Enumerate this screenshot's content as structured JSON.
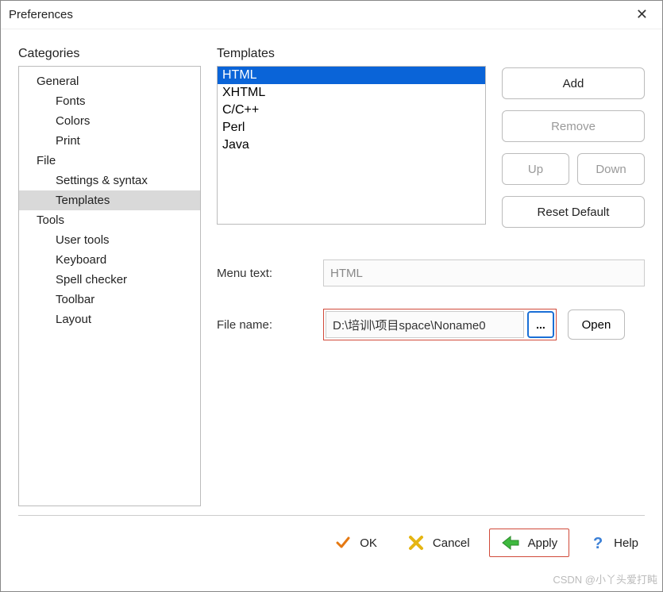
{
  "window": {
    "title": "Preferences"
  },
  "categories": {
    "label": "Categories",
    "items": [
      {
        "label": "General",
        "level": 0
      },
      {
        "label": "Fonts",
        "level": 1
      },
      {
        "label": "Colors",
        "level": 1
      },
      {
        "label": "Print",
        "level": 1
      },
      {
        "label": "File",
        "level": 0
      },
      {
        "label": "Settings & syntax",
        "level": 1
      },
      {
        "label": "Templates",
        "level": 1,
        "selected": true
      },
      {
        "label": "Tools",
        "level": 0
      },
      {
        "label": "User tools",
        "level": 1
      },
      {
        "label": "Keyboard",
        "level": 1
      },
      {
        "label": "Spell checker",
        "level": 1
      },
      {
        "label": "Toolbar",
        "level": 1
      },
      {
        "label": "Layout",
        "level": 1
      }
    ]
  },
  "templates": {
    "label": "Templates",
    "items": [
      {
        "label": "HTML",
        "selected": true
      },
      {
        "label": "XHTML"
      },
      {
        "label": "C/C++"
      },
      {
        "label": "Perl"
      },
      {
        "label": "Java"
      }
    ]
  },
  "buttons": {
    "add": "Add",
    "remove": "Remove",
    "up": "Up",
    "down": "Down",
    "reset": "Reset Default",
    "browse": "...",
    "open": "Open"
  },
  "form": {
    "menu_label": "Menu text:",
    "menu_value": "HTML",
    "file_label": "File name:",
    "file_value": "D:\\培训\\项目space\\Noname0"
  },
  "footer": {
    "ok": "OK",
    "cancel": "Cancel",
    "apply": "Apply",
    "help": "Help"
  },
  "watermark": "CSDN @小丫头爱打盹"
}
